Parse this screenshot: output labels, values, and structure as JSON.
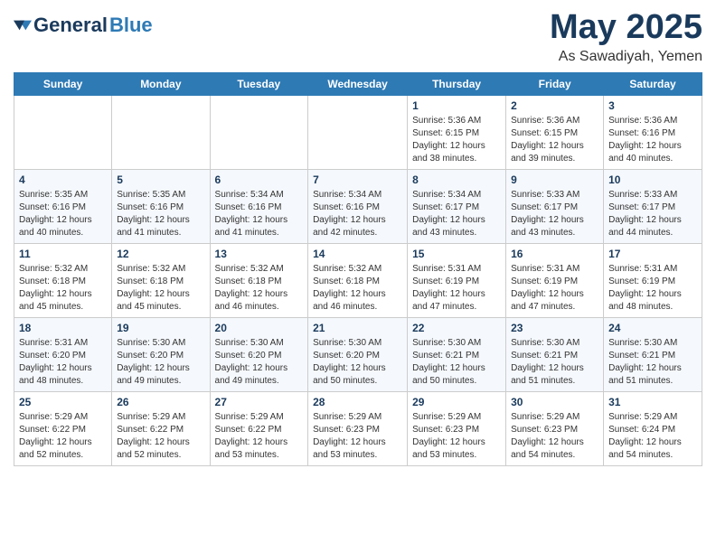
{
  "header": {
    "logo_general": "General",
    "logo_blue": "Blue",
    "title": "May 2025",
    "location": "As Sawadiyah, Yemen"
  },
  "days_of_week": [
    "Sunday",
    "Monday",
    "Tuesday",
    "Wednesday",
    "Thursday",
    "Friday",
    "Saturday"
  ],
  "weeks": [
    [
      {
        "day": "",
        "info": ""
      },
      {
        "day": "",
        "info": ""
      },
      {
        "day": "",
        "info": ""
      },
      {
        "day": "",
        "info": ""
      },
      {
        "day": "1",
        "info": "Sunrise: 5:36 AM\nSunset: 6:15 PM\nDaylight: 12 hours\nand 38 minutes."
      },
      {
        "day": "2",
        "info": "Sunrise: 5:36 AM\nSunset: 6:15 PM\nDaylight: 12 hours\nand 39 minutes."
      },
      {
        "day": "3",
        "info": "Sunrise: 5:36 AM\nSunset: 6:16 PM\nDaylight: 12 hours\nand 40 minutes."
      }
    ],
    [
      {
        "day": "4",
        "info": "Sunrise: 5:35 AM\nSunset: 6:16 PM\nDaylight: 12 hours\nand 40 minutes."
      },
      {
        "day": "5",
        "info": "Sunrise: 5:35 AM\nSunset: 6:16 PM\nDaylight: 12 hours\nand 41 minutes."
      },
      {
        "day": "6",
        "info": "Sunrise: 5:34 AM\nSunset: 6:16 PM\nDaylight: 12 hours\nand 41 minutes."
      },
      {
        "day": "7",
        "info": "Sunrise: 5:34 AM\nSunset: 6:16 PM\nDaylight: 12 hours\nand 42 minutes."
      },
      {
        "day": "8",
        "info": "Sunrise: 5:34 AM\nSunset: 6:17 PM\nDaylight: 12 hours\nand 43 minutes."
      },
      {
        "day": "9",
        "info": "Sunrise: 5:33 AM\nSunset: 6:17 PM\nDaylight: 12 hours\nand 43 minutes."
      },
      {
        "day": "10",
        "info": "Sunrise: 5:33 AM\nSunset: 6:17 PM\nDaylight: 12 hours\nand 44 minutes."
      }
    ],
    [
      {
        "day": "11",
        "info": "Sunrise: 5:32 AM\nSunset: 6:18 PM\nDaylight: 12 hours\nand 45 minutes."
      },
      {
        "day": "12",
        "info": "Sunrise: 5:32 AM\nSunset: 6:18 PM\nDaylight: 12 hours\nand 45 minutes."
      },
      {
        "day": "13",
        "info": "Sunrise: 5:32 AM\nSunset: 6:18 PM\nDaylight: 12 hours\nand 46 minutes."
      },
      {
        "day": "14",
        "info": "Sunrise: 5:32 AM\nSunset: 6:18 PM\nDaylight: 12 hours\nand 46 minutes."
      },
      {
        "day": "15",
        "info": "Sunrise: 5:31 AM\nSunset: 6:19 PM\nDaylight: 12 hours\nand 47 minutes."
      },
      {
        "day": "16",
        "info": "Sunrise: 5:31 AM\nSunset: 6:19 PM\nDaylight: 12 hours\nand 47 minutes."
      },
      {
        "day": "17",
        "info": "Sunrise: 5:31 AM\nSunset: 6:19 PM\nDaylight: 12 hours\nand 48 minutes."
      }
    ],
    [
      {
        "day": "18",
        "info": "Sunrise: 5:31 AM\nSunset: 6:20 PM\nDaylight: 12 hours\nand 48 minutes."
      },
      {
        "day": "19",
        "info": "Sunrise: 5:30 AM\nSunset: 6:20 PM\nDaylight: 12 hours\nand 49 minutes."
      },
      {
        "day": "20",
        "info": "Sunrise: 5:30 AM\nSunset: 6:20 PM\nDaylight: 12 hours\nand 49 minutes."
      },
      {
        "day": "21",
        "info": "Sunrise: 5:30 AM\nSunset: 6:20 PM\nDaylight: 12 hours\nand 50 minutes."
      },
      {
        "day": "22",
        "info": "Sunrise: 5:30 AM\nSunset: 6:21 PM\nDaylight: 12 hours\nand 50 minutes."
      },
      {
        "day": "23",
        "info": "Sunrise: 5:30 AM\nSunset: 6:21 PM\nDaylight: 12 hours\nand 51 minutes."
      },
      {
        "day": "24",
        "info": "Sunrise: 5:30 AM\nSunset: 6:21 PM\nDaylight: 12 hours\nand 51 minutes."
      }
    ],
    [
      {
        "day": "25",
        "info": "Sunrise: 5:29 AM\nSunset: 6:22 PM\nDaylight: 12 hours\nand 52 minutes."
      },
      {
        "day": "26",
        "info": "Sunrise: 5:29 AM\nSunset: 6:22 PM\nDaylight: 12 hours\nand 52 minutes."
      },
      {
        "day": "27",
        "info": "Sunrise: 5:29 AM\nSunset: 6:22 PM\nDaylight: 12 hours\nand 53 minutes."
      },
      {
        "day": "28",
        "info": "Sunrise: 5:29 AM\nSunset: 6:23 PM\nDaylight: 12 hours\nand 53 minutes."
      },
      {
        "day": "29",
        "info": "Sunrise: 5:29 AM\nSunset: 6:23 PM\nDaylight: 12 hours\nand 53 minutes."
      },
      {
        "day": "30",
        "info": "Sunrise: 5:29 AM\nSunset: 6:23 PM\nDaylight: 12 hours\nand 54 minutes."
      },
      {
        "day": "31",
        "info": "Sunrise: 5:29 AM\nSunset: 6:24 PM\nDaylight: 12 hours\nand 54 minutes."
      }
    ]
  ]
}
